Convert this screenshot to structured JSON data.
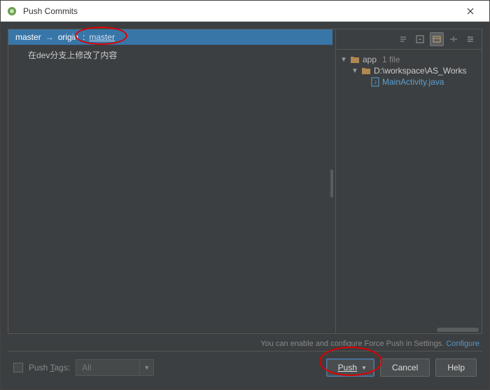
{
  "window": {
    "title": "Push Commits"
  },
  "branch": {
    "local": "master",
    "remote": "origin",
    "target": "master"
  },
  "commits": [
    {
      "message": "在dev分支上修改了内容"
    }
  ],
  "toolbar_icons": [
    "expand-all-icon",
    "collapse-all-icon",
    "group-by-icon",
    "diff-icon",
    "settings-icon"
  ],
  "tree": {
    "root": {
      "name": "app",
      "count": "1 file"
    },
    "path": "D:\\workspace\\AS_Works",
    "file": "MainActivity.java"
  },
  "hint": {
    "text": "You can enable and configure Force Push in Settings.",
    "link": "Configure"
  },
  "footer": {
    "push_tags_label": "Push Tags:",
    "push_tags_value": "All",
    "buttons": {
      "push": "Push",
      "cancel": "Cancel",
      "help": "Help"
    }
  }
}
